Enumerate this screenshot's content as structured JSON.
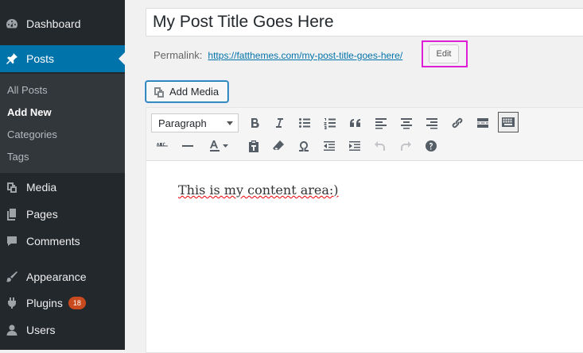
{
  "sidebar": {
    "items": [
      {
        "label": "Dashboard",
        "icon": "dashboard-icon"
      },
      {
        "label": "Posts",
        "icon": "pushpin-icon"
      },
      {
        "label": "Media",
        "icon": "media-icon"
      },
      {
        "label": "Pages",
        "icon": "pages-icon"
      },
      {
        "label": "Comments",
        "icon": "comments-icon"
      },
      {
        "label": "Appearance",
        "icon": "appearance-icon"
      },
      {
        "label": "Plugins",
        "icon": "plugins-icon",
        "badge": "18"
      },
      {
        "label": "Users",
        "icon": "users-icon"
      }
    ],
    "submenu": [
      "All Posts",
      "Add New",
      "Categories",
      "Tags"
    ]
  },
  "post": {
    "title": "My Post Title Goes Here",
    "permalink_label": "Permalink:",
    "permalink_url": "https://fatthemes.com/my-post-title-goes-here/",
    "edit_label": "Edit"
  },
  "add_media_label": "Add Media",
  "editor": {
    "format_select": "Paragraph",
    "content_text": "This is my content area:)"
  },
  "colors": {
    "sidebar_bg": "#23282d",
    "active": "#0073aa",
    "badge": "#ca4a1f",
    "highlight": "#e01ed6"
  }
}
